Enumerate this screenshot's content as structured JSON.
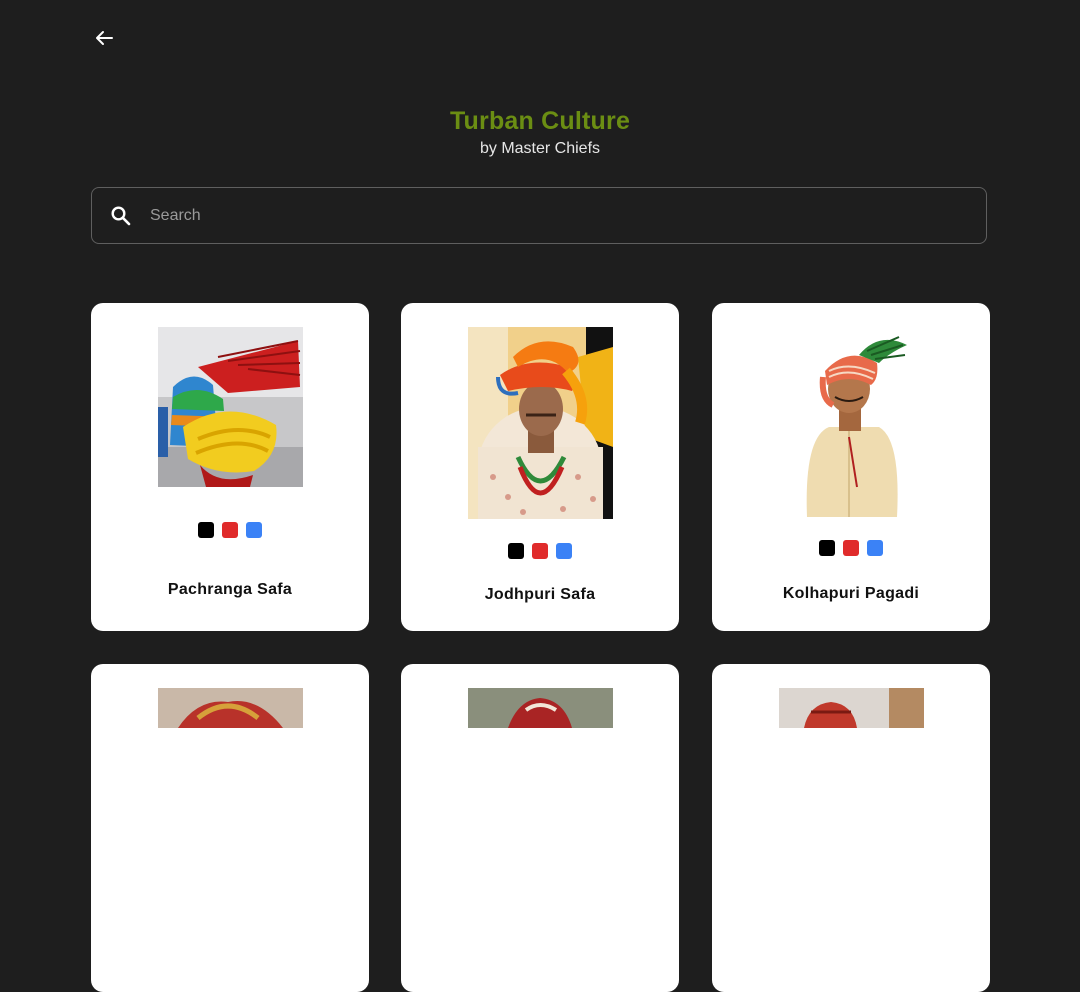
{
  "header": {
    "title": "Turban Culture",
    "subtitle": "by Master Chiefs"
  },
  "search": {
    "placeholder": "Search",
    "value": ""
  },
  "swatch_colors": [
    "#000000",
    "#e02b2b",
    "#3b82f6"
  ],
  "products": [
    {
      "name": "Pachranga Safa"
    },
    {
      "name": "Jodhpuri Safa"
    },
    {
      "name": "Kolhapuri Pagadi"
    },
    {
      "name": ""
    },
    {
      "name": ""
    },
    {
      "name": ""
    }
  ]
}
